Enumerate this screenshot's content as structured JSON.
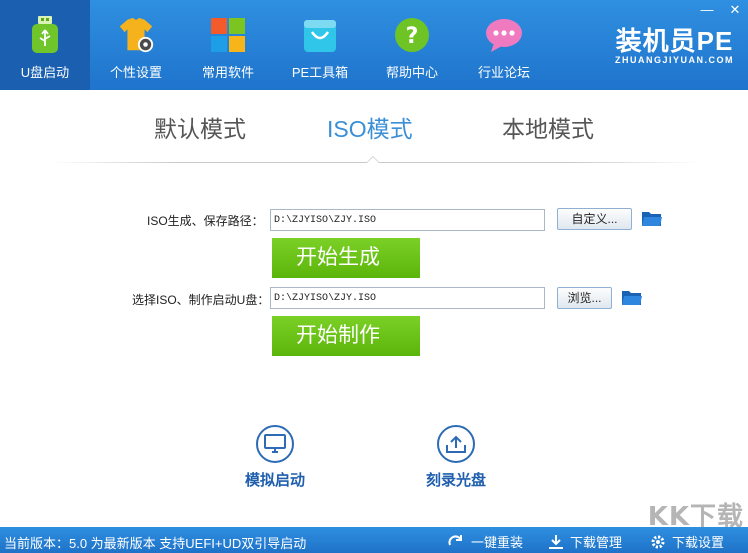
{
  "window": {
    "controls": [
      "—",
      "✕"
    ]
  },
  "nav": {
    "items": [
      {
        "label": "U盘启动",
        "icon": "usb-icon",
        "active": true
      },
      {
        "label": "个性设置",
        "icon": "tshirt-gear-icon"
      },
      {
        "label": "常用软件",
        "icon": "tiles-icon"
      },
      {
        "label": "PE工具箱",
        "icon": "shopping-bag-icon"
      },
      {
        "label": "帮助中心",
        "icon": "help-icon"
      },
      {
        "label": "行业论坛",
        "icon": "chat-bubble-icon"
      }
    ],
    "brand": {
      "name": "装机员PE",
      "domain": "ZHUANGJIYUAN.COM"
    }
  },
  "tabs": [
    {
      "label": "默认模式"
    },
    {
      "label": "ISO模式",
      "active": true
    },
    {
      "label": "本地模式"
    }
  ],
  "iso": {
    "save_label": "ISO生成、保存路径：",
    "save_path": "D:\\ZJYISO\\ZJY.ISO",
    "custom_button": "自定义...",
    "generate_button": "开始生成",
    "select_label": "选择ISO、制作启动U盘：",
    "select_path": "D:\\ZJYISO\\ZJY.ISO",
    "browse_button": "浏览...",
    "make_button": "开始制作"
  },
  "actions": [
    {
      "label": "模拟启动",
      "icon": "monitor-icon"
    },
    {
      "label": "刻录光盘",
      "icon": "upload-tray-icon"
    }
  ],
  "status": {
    "version_text": "当前版本：5.0 为最新版本 支持UEFI+UD双引导启动",
    "reinstall": "一键重装",
    "download_manage": "下载管理",
    "download_settings": "下载设置"
  },
  "watermark": "KK下载",
  "colors": {
    "accent": "#2b86da",
    "green": "#6cc418",
    "active_tab": "#3a8fd6"
  }
}
